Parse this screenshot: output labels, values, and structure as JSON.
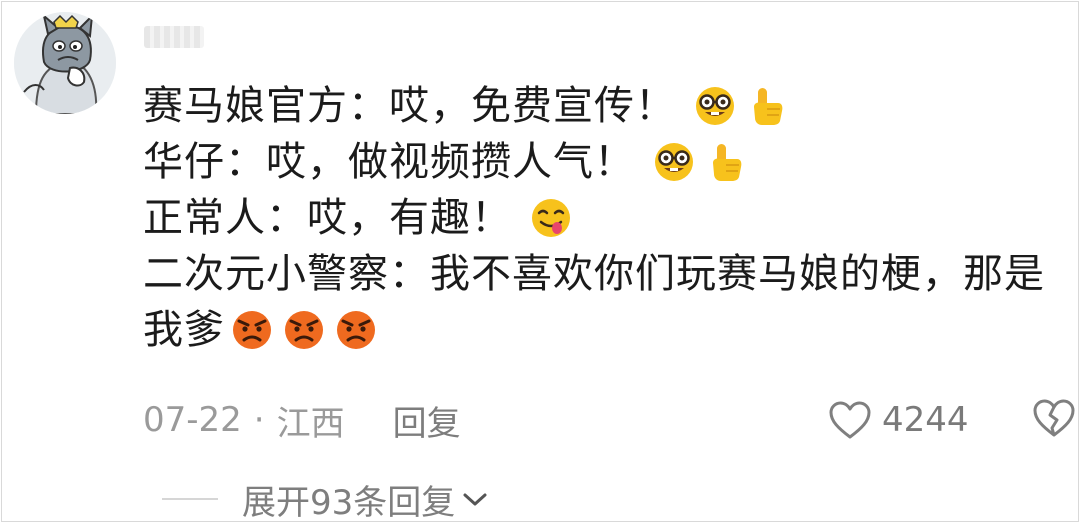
{
  "comment": {
    "lines": [
      {
        "text": "赛马娘官方：哎，免费宣传！",
        "emojis": [
          "nerd-face-emoji",
          "pointing-up-emoji"
        ]
      },
      {
        "text": "华仔：哎，做视频攒人气！",
        "emojis": [
          "nerd-face-emoji",
          "pointing-up-emoji"
        ]
      },
      {
        "text": "正常人：哎，有趣！",
        "emojis": [
          "savoring-food-face-emoji"
        ]
      },
      {
        "text": "二次元小警察：我不喜欢你们玩赛马娘的梗，那是",
        "emojis": []
      },
      {
        "text": "我爹",
        "emojis": [
          "angry-face-emoji",
          "angry-face-emoji",
          "angry-face-emoji"
        ]
      }
    ]
  },
  "meta": {
    "date": "07-22",
    "separator": "·",
    "location": "江西",
    "reply_label": "回复"
  },
  "likes": {
    "count": "4244",
    "icon": "heart-outline-icon"
  },
  "dislike": {
    "icon": "broken-heart-icon"
  },
  "expand": {
    "label": "展开93条回复",
    "icon": "chevron-down-icon"
  },
  "colors": {
    "text": "#1b1b1b",
    "meta": "#9a9a9a",
    "emoji_yellow": "#f7c21c",
    "emoji_angry": "#ef6a1f"
  }
}
